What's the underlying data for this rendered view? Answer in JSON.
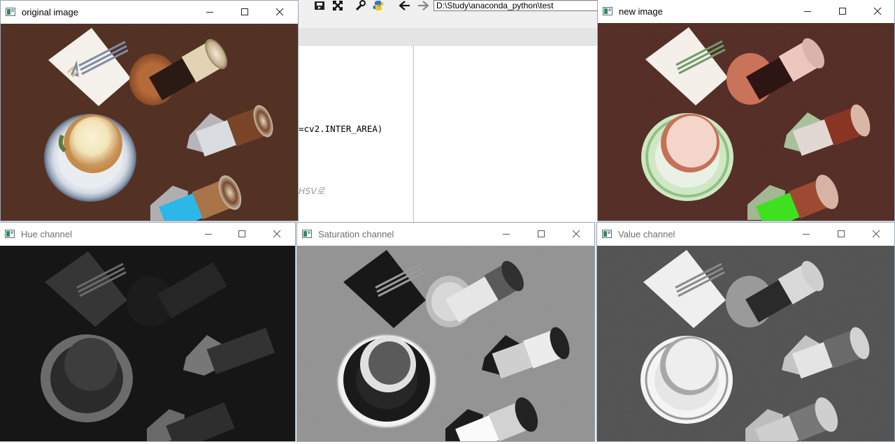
{
  "ide": {
    "path": "D:\\Study\\anaconda_python\\test",
    "code_fragment": "=cv2.INTER_AREA)",
    "comment_fragment": "HSV로",
    "toolbar_icons": [
      "save-run-icon",
      "maximize-arrows-icon",
      "wrench-icon",
      "python-icon",
      "back-arrow-icon",
      "forward-arrow-icon"
    ]
  },
  "windows": {
    "original": {
      "title": "original image",
      "active": true
    },
    "new": {
      "title": "new image",
      "active": true
    },
    "hue": {
      "title": "Hue channel",
      "active": false
    },
    "saturation": {
      "title": "Saturation channel",
      "active": false
    },
    "value": {
      "title": "Value channel",
      "active": false
    }
  },
  "colors": {
    "table_wood": "#4a2b20",
    "accent_blue": "#2bb8e8",
    "accent_green": "#3fe020"
  }
}
